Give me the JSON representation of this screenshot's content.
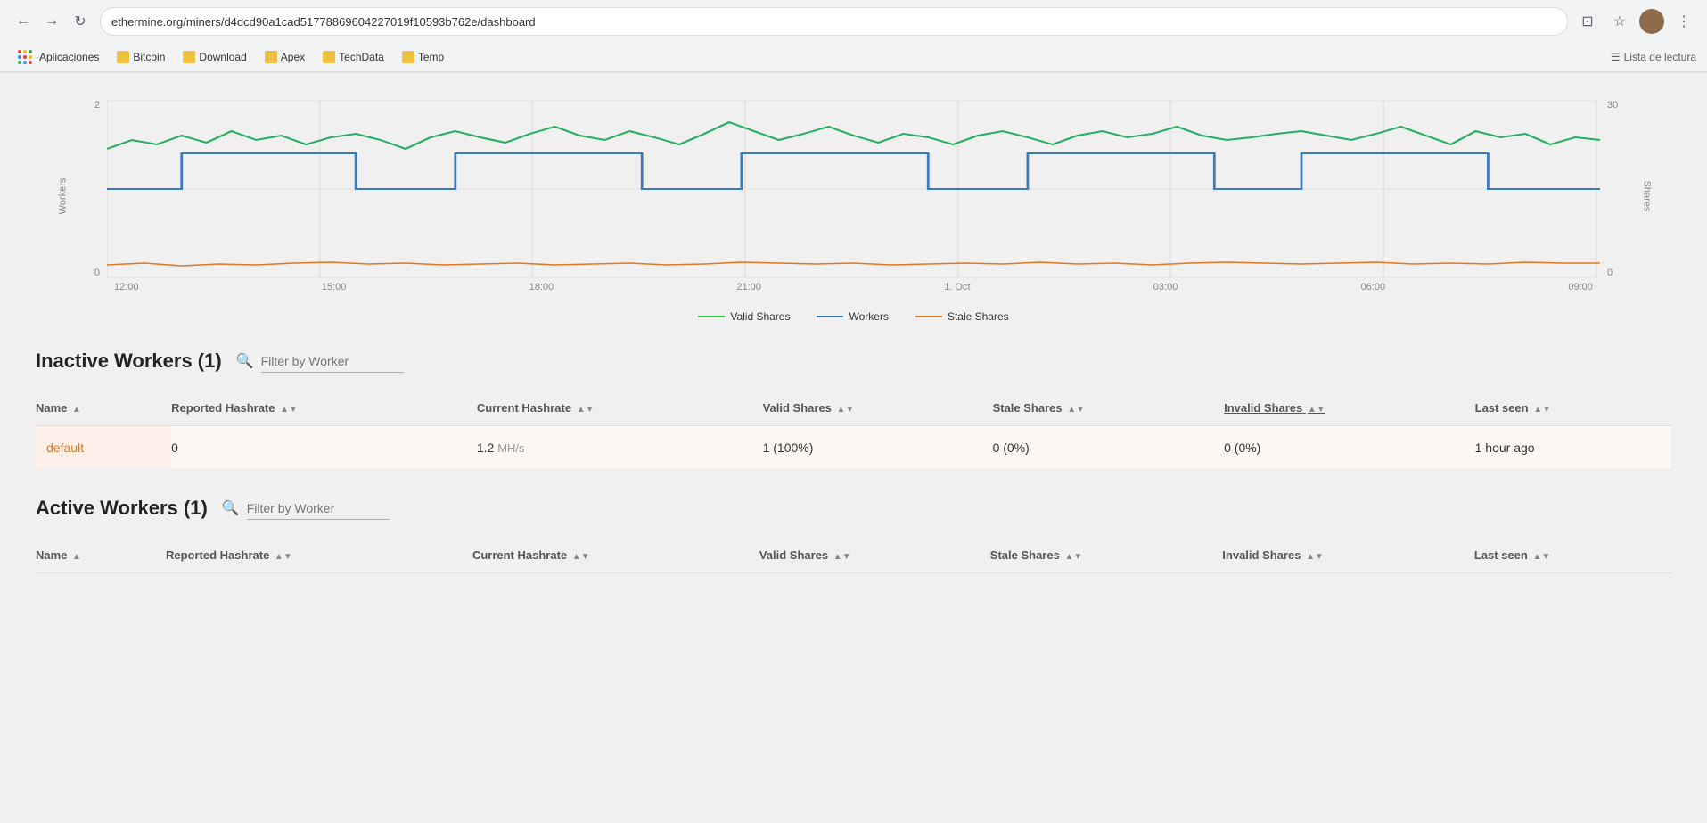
{
  "browser": {
    "url": "ethermine.org/miners/d4dcd90a1cad51778869604227019f10593b762e/dashboard",
    "nav": {
      "back": "←",
      "forward": "→",
      "reload": "↻"
    },
    "bookmarks": [
      {
        "id": "apps",
        "label": "Aplicaciones",
        "color": "multi"
      },
      {
        "id": "bitcoin",
        "label": "Bitcoin",
        "color": "gold"
      },
      {
        "id": "download",
        "label": "Download",
        "color": "gold"
      },
      {
        "id": "apex",
        "label": "Apex",
        "color": "gold"
      },
      {
        "id": "techdata",
        "label": "TechData",
        "color": "gold"
      },
      {
        "id": "temp",
        "label": "Temp",
        "color": "gold"
      }
    ],
    "reading_list": "Lista de lectura"
  },
  "chart": {
    "x_labels": [
      "12:00",
      "15:00",
      "18:00",
      "21:00",
      "1. Oct",
      "03:00",
      "06:00",
      "09:00"
    ],
    "y_left_label": "Workers",
    "y_right_label": "Shares",
    "y_left_values": [
      "2",
      "0"
    ],
    "y_right_values": [
      "30",
      "0"
    ],
    "legend": [
      {
        "id": "valid",
        "label": "Valid Shares",
        "color": "green"
      },
      {
        "id": "workers",
        "label": "Workers",
        "color": "blue"
      },
      {
        "id": "stale",
        "label": "Stale Shares",
        "color": "orange"
      }
    ]
  },
  "inactive_workers": {
    "title": "Inactive Workers (1)",
    "filter_placeholder": "Filter by Worker",
    "columns": [
      {
        "id": "name",
        "label": "Name",
        "sorted": false
      },
      {
        "id": "reported_hashrate",
        "label": "Reported Hashrate",
        "sorted": false
      },
      {
        "id": "current_hashrate",
        "label": "Current Hashrate",
        "sorted": false
      },
      {
        "id": "valid_shares",
        "label": "Valid Shares",
        "sorted": false
      },
      {
        "id": "stale_shares",
        "label": "Stale Shares",
        "sorted": false
      },
      {
        "id": "invalid_shares",
        "label": "Invalid Shares",
        "sorted": true
      },
      {
        "id": "last_seen",
        "label": "Last seen",
        "sorted": false
      }
    ],
    "rows": [
      {
        "name": "default",
        "reported_hashrate": "0",
        "current_hashrate": "1.2",
        "current_hashrate_unit": "MH/s",
        "valid_shares": "1 (100%)",
        "stale_shares": "0 (0%)",
        "invalid_shares": "0 (0%)",
        "last_seen": "1 hour ago",
        "inactive": true
      }
    ]
  },
  "active_workers": {
    "title": "Active Workers (1)",
    "filter_placeholder": "Filter by Worker",
    "columns": [
      {
        "id": "name",
        "label": "Name",
        "sorted": false
      },
      {
        "id": "reported_hashrate",
        "label": "Reported Hashrate",
        "sorted": false
      },
      {
        "id": "current_hashrate",
        "label": "Current Hashrate",
        "sorted": false
      },
      {
        "id": "valid_shares",
        "label": "Valid Shares",
        "sorted": false
      },
      {
        "id": "stale_shares",
        "label": "Stale Shares",
        "sorted": false
      },
      {
        "id": "invalid_shares",
        "label": "Invalid Shares",
        "sorted": false
      },
      {
        "id": "last_seen",
        "label": "Last seen",
        "sorted": false
      }
    ],
    "rows": []
  }
}
